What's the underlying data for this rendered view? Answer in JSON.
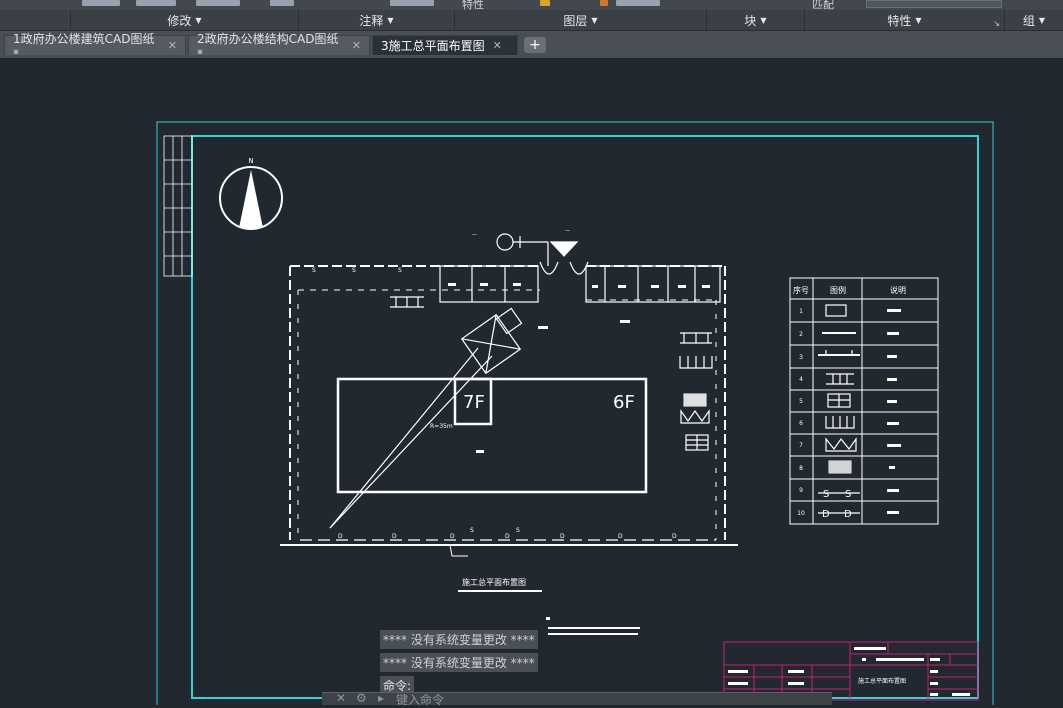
{
  "ribbon": {
    "panels": [
      {
        "label": "修改"
      },
      {
        "label": "注释"
      },
      {
        "label": "图层"
      },
      {
        "label": "块"
      },
      {
        "label": "特性"
      },
      {
        "label": "组"
      }
    ],
    "partial_labels": [
      "特性",
      "匹配"
    ]
  },
  "tabs": [
    {
      "label": "1政府办公楼建筑CAD图纸*"
    },
    {
      "label": "2政府办公楼结构CAD图纸*"
    },
    {
      "label": "3施工总平面布置图"
    }
  ],
  "drawing": {
    "north_label": "N",
    "building_labels": {
      "tall": "7F",
      "main": "6F"
    },
    "crane_radius": "R=35m",
    "plan_title": "施工总平面布置图",
    "legend_headers": [
      "序号",
      "图例",
      "说明"
    ],
    "legend_numbers": [
      "1",
      "2",
      "3",
      "4",
      "5",
      "6",
      "7",
      "8",
      "9",
      "10"
    ],
    "line_markers": {
      "s": "S",
      "d": "D"
    },
    "title_block_name": "施工总平面布置图"
  },
  "command": {
    "history": [
      "****  没有系统变量更改  ****",
      "****  没有系统变量更改  ****"
    ],
    "prompt": "命令:",
    "input_placeholder": "键入命令"
  }
}
